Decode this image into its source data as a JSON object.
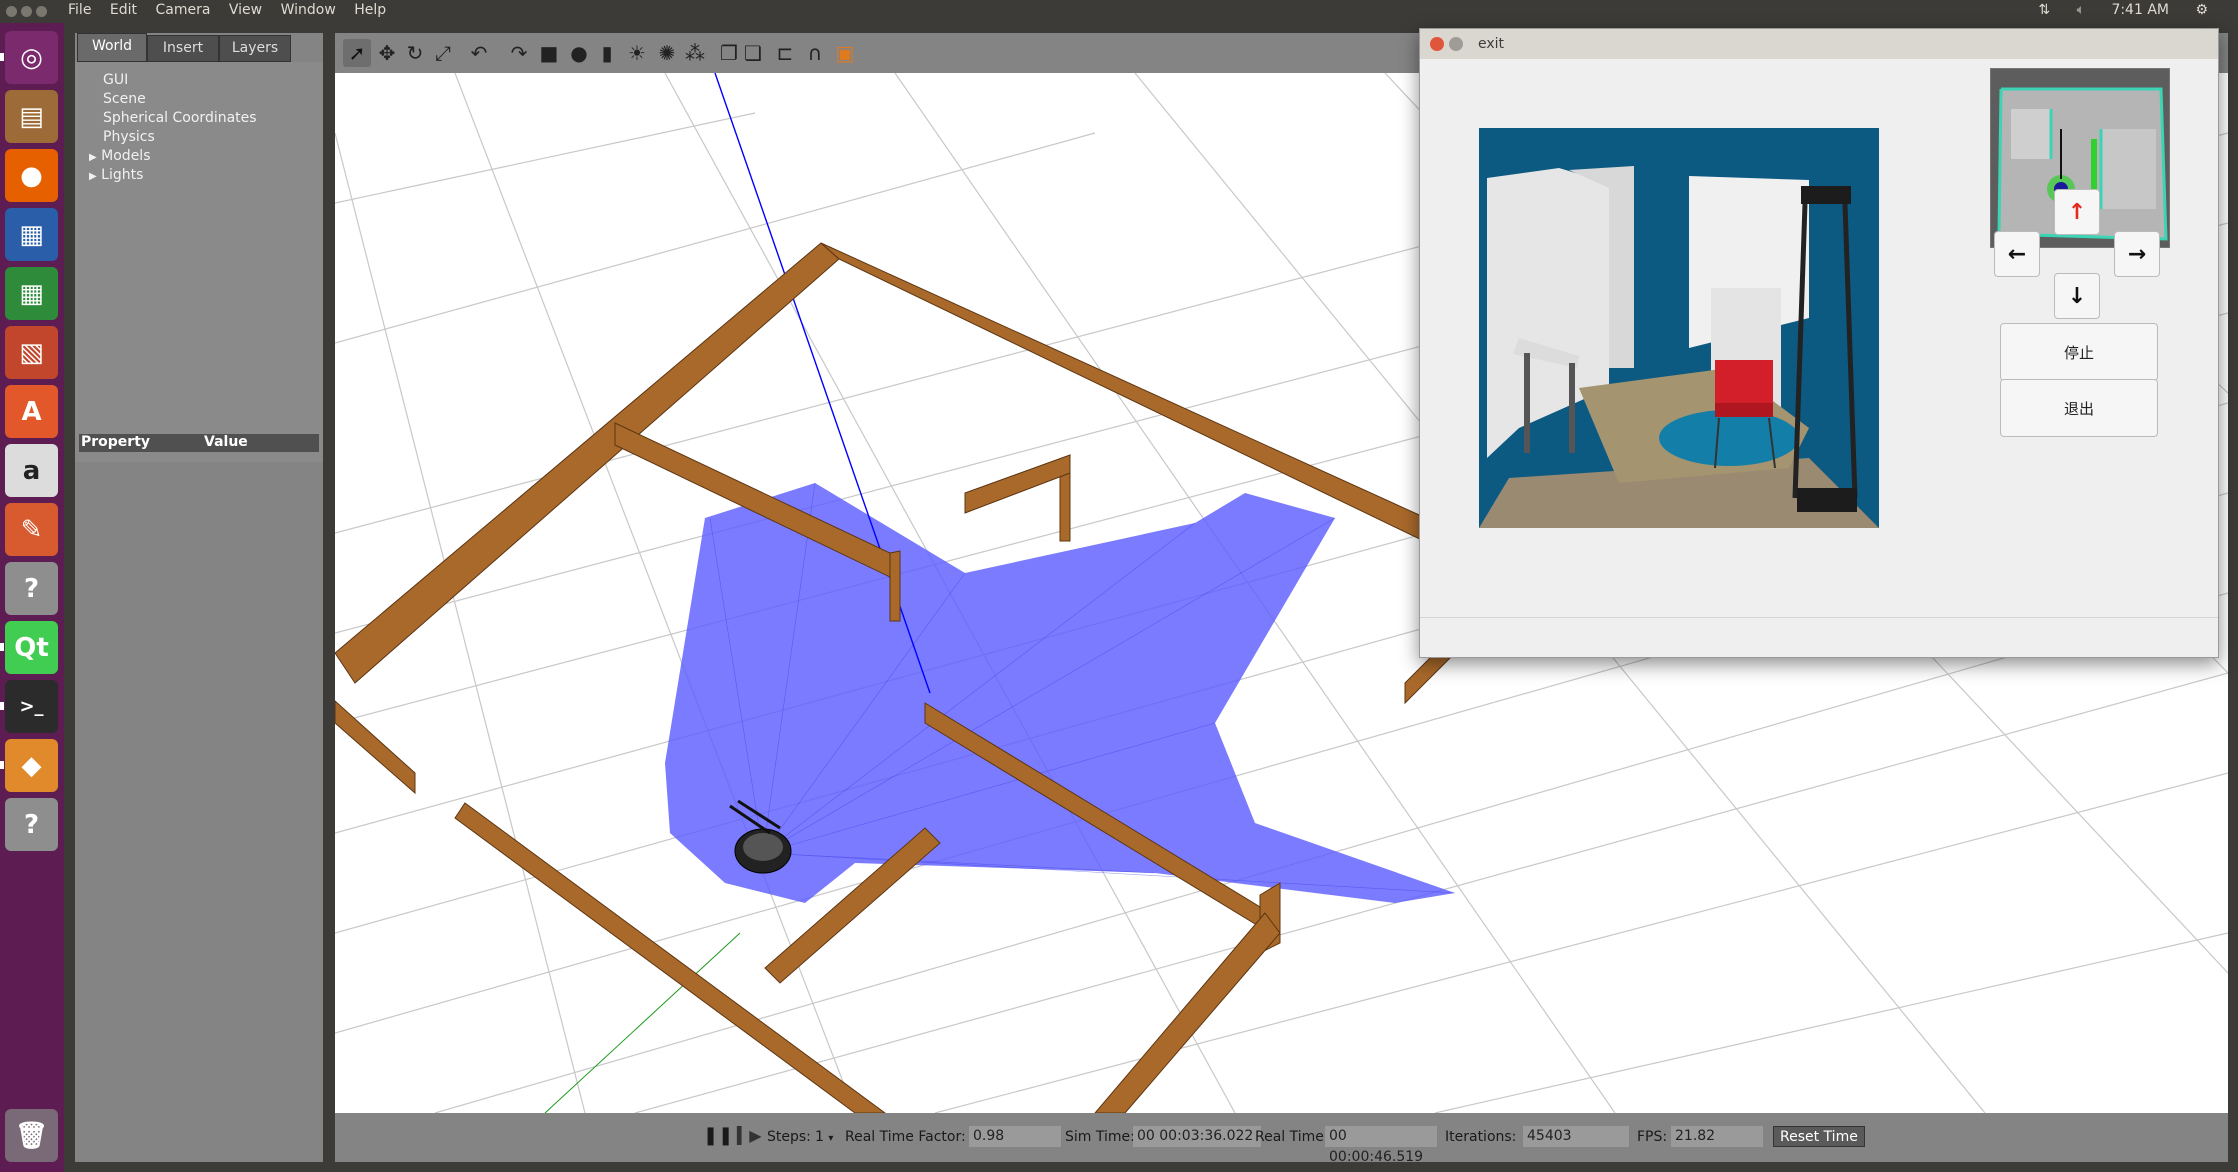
{
  "topbar": {
    "menu": [
      "File",
      "Edit",
      "Camera",
      "View",
      "Window",
      "Help"
    ],
    "clock": "7:41 AM",
    "network_icon": "network-icon",
    "volume_icon": "volume-icon",
    "settings_icon": "gear-icon"
  },
  "launcher": {
    "items": [
      {
        "name": "ubuntu-logo-icon",
        "color": "#7b2a6d"
      },
      {
        "name": "files-icon",
        "color": "#9c6b37"
      },
      {
        "name": "firefox-icon",
        "color": "#e66000"
      },
      {
        "name": "writer-icon",
        "color": "#2a5ea8"
      },
      {
        "name": "calc-icon",
        "color": "#2e8b3a"
      },
      {
        "name": "impress-icon",
        "color": "#c2462c"
      },
      {
        "name": "software-center-icon",
        "color": "#e2582a"
      },
      {
        "name": "amazon-icon",
        "color": "#dcdcdc"
      },
      {
        "name": "system-settings-icon",
        "color": "#d75b2e"
      },
      {
        "name": "unknown-app-icon",
        "color": "#8e8e8e"
      },
      {
        "name": "qt-creator-icon",
        "color": "#41cd52"
      },
      {
        "name": "terminal-icon",
        "color": "#2b2b2b"
      },
      {
        "name": "gazebo-icon",
        "color": "#e08a2b"
      },
      {
        "name": "unknown-app-icon-2",
        "color": "#8e8e8e"
      }
    ],
    "trash": "trash-icon"
  },
  "left_panel": {
    "tabs": [
      "World",
      "Insert",
      "Layers"
    ],
    "tree": [
      "GUI",
      "Scene",
      "Spherical Coordinates",
      "Physics",
      "Models",
      "Lights"
    ],
    "props_header": {
      "property": "Property",
      "value": "Value"
    }
  },
  "toolbar": {
    "tools": [
      "select-icon",
      "translate-icon",
      "rotate-icon",
      "scale-icon",
      "undo-icon",
      "redo-icon",
      "box-icon",
      "sphere-icon",
      "cylinder-icon",
      "sun-icon",
      "point-light-icon",
      "spot-light-icon",
      "copy-icon",
      "paste-icon",
      "align-icon",
      "snap-icon",
      "view-angle-icon"
    ]
  },
  "bottombar": {
    "pause_icon": "pause-icon",
    "step_icon": "step-icon",
    "steps_label": "Steps:",
    "steps_value": "1",
    "rtf_label": "Real Time Factor:",
    "rtf_value": "0.98",
    "sim_label": "Sim Time:",
    "sim_value": "00 00:03:36.022",
    "real_label": "Real Time:",
    "real_value": "00 00:00:46.519",
    "iter_label": "Iterations:",
    "iter_value": "45403",
    "fps_label": "FPS:",
    "fps_value": "21.82",
    "reset_label": "Reset Time"
  },
  "dialog": {
    "title": "exit",
    "up": "↑",
    "left": "←",
    "right": "→",
    "down": "↓",
    "stop": "停止",
    "quit": "退出"
  }
}
